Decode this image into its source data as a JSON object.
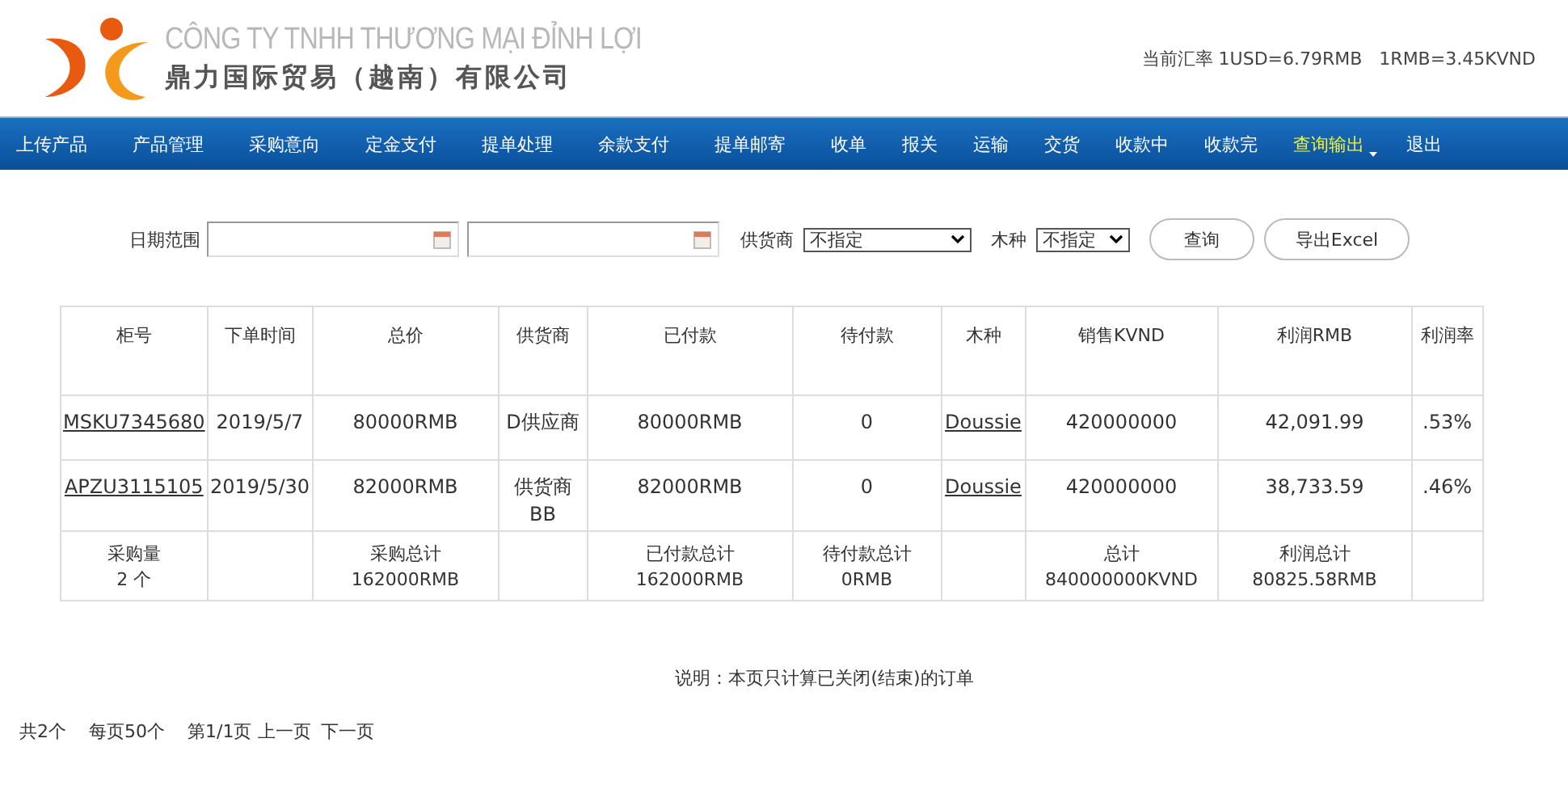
{
  "header": {
    "company_vn": "CÔNG TY TNHH THƯƠNG MẠI ĐỈNH LỢI",
    "company_cn": "鼎力国际贸易（越南）有限公司",
    "exchange_rate": "当前汇率 1USD=6.79RMB   1RMB=3.45KVND"
  },
  "nav": [
    {
      "label": "上传产品",
      "selected": false
    },
    {
      "label": "产品管理",
      "selected": false
    },
    {
      "label": "采购意向",
      "selected": false
    },
    {
      "label": "定金支付",
      "selected": false
    },
    {
      "label": "提单处理",
      "selected": false
    },
    {
      "label": "余款支付",
      "selected": false
    },
    {
      "label": "提单邮寄",
      "selected": false
    },
    {
      "label": "收单",
      "selected": false
    },
    {
      "label": "报关",
      "selected": false
    },
    {
      "label": "运输",
      "selected": false
    },
    {
      "label": "交货",
      "selected": false
    },
    {
      "label": "收款中",
      "selected": false
    },
    {
      "label": "收款完",
      "selected": false
    },
    {
      "label": "查询输出",
      "selected": true
    },
    {
      "label": "退出",
      "selected": false
    }
  ],
  "filters": {
    "date_label": "日期范围",
    "supplier_label": "供货商",
    "supplier_value": "不指定",
    "wood_label": "木种",
    "wood_value": "不指定",
    "buttons": [
      "查询",
      "导出Excel"
    ]
  },
  "table": {
    "columns": [
      "柜号",
      "下单时间",
      "总价",
      "供货商",
      "已付款",
      "待付款",
      "木种",
      "销售KVND",
      "利润RMB",
      "利润率"
    ],
    "rows": [
      [
        {
          "kind": "link",
          "text": "MSKU7345680"
        },
        {
          "kind": "text",
          "text": "2019/5/7"
        },
        {
          "kind": "text",
          "text": "80000RMB"
        },
        {
          "kind": "text",
          "text": "D供应商"
        },
        {
          "kind": "text",
          "text": "80000RMB"
        },
        {
          "kind": "text",
          "text": "0"
        },
        {
          "kind": "link",
          "text": "Doussie"
        },
        {
          "kind": "text",
          "text": "420000000"
        },
        {
          "kind": "text",
          "text": "42,091.99"
        },
        {
          "kind": "text",
          "text": ".53%"
        }
      ],
      [
        {
          "kind": "link",
          "text": "APZU3115105"
        },
        {
          "kind": "text",
          "text": "2019/5/30"
        },
        {
          "kind": "text",
          "text": "82000RMB"
        },
        {
          "kind": "text",
          "text": "供货商BB"
        },
        {
          "kind": "text",
          "text": "82000RMB"
        },
        {
          "kind": "text",
          "text": "0"
        },
        {
          "kind": "link",
          "text": "Doussie"
        },
        {
          "kind": "text",
          "text": "420000000"
        },
        {
          "kind": "text",
          "text": "38,733.59"
        },
        {
          "kind": "text",
          "text": ".46%"
        }
      ]
    ],
    "totals": [
      {
        "kind": "total",
        "label": "采购量",
        "value": "2 个"
      },
      {
        "kind": "empty"
      },
      {
        "kind": "total",
        "label": "采购总计",
        "value": "162000RMB"
      },
      {
        "kind": "empty"
      },
      {
        "kind": "total",
        "label": "已付款总计",
        "value": "162000RMB"
      },
      {
        "kind": "total",
        "label": "待付款总计",
        "value": "0RMB"
      },
      {
        "kind": "empty"
      },
      {
        "kind": "total",
        "label": "总计",
        "value": "840000000KVND"
      },
      {
        "kind": "total",
        "label": "利润总计",
        "value": "80825.58RMB"
      },
      {
        "kind": "empty"
      }
    ]
  },
  "note": "说明：本页只计算已关闭(结束)的订单",
  "pager": {
    "total": "共2个",
    "per_page": "每页50个",
    "page": "第1/1页",
    "prev": "上一页",
    "next": "下一页"
  }
}
